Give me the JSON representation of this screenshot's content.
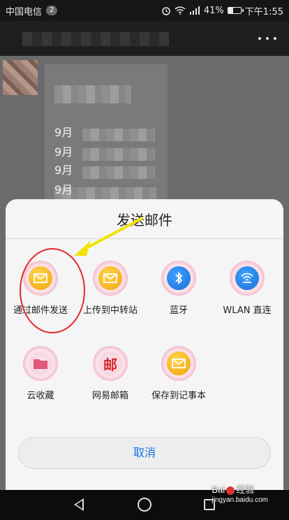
{
  "status_bar": {
    "carrier": "中国电信",
    "notification_count": "2",
    "battery_percent": "41%",
    "battery_level": 0.41,
    "time": "下午1:55"
  },
  "chat": {
    "message_lines": [
      "9月",
      "9月",
      "9月",
      "9月"
    ]
  },
  "share_sheet": {
    "title": "发送邮件",
    "row1": [
      {
        "label": "通过邮件发送",
        "icon": "envelope-icon",
        "color": "#f4a20f"
      },
      {
        "label": "上传到中转站",
        "icon": "envelope-icon",
        "color": "#f4a20f"
      },
      {
        "label": "蓝牙",
        "icon": "bluetooth-icon",
        "color": "#1a6fd6"
      },
      {
        "label": "WLAN 直连",
        "icon": "wifi-direct-icon",
        "color": "#1a6fd6"
      }
    ],
    "row2": [
      {
        "label": "云收藏",
        "icon": "folder-icon",
        "color": "#e05a78"
      },
      {
        "label": "网易邮箱",
        "icon": "netease-mail-icon",
        "color": "#d7262c"
      },
      {
        "label": "保存到记事本",
        "icon": "envelope-icon",
        "color": "#f4a20f"
      }
    ],
    "cancel_label": "取消"
  },
  "netease_glyph": "邮",
  "watermark": {
    "brand_left": "Bai",
    "brand_right": "经验",
    "brand_domain": "jingyan.baidu.com"
  }
}
